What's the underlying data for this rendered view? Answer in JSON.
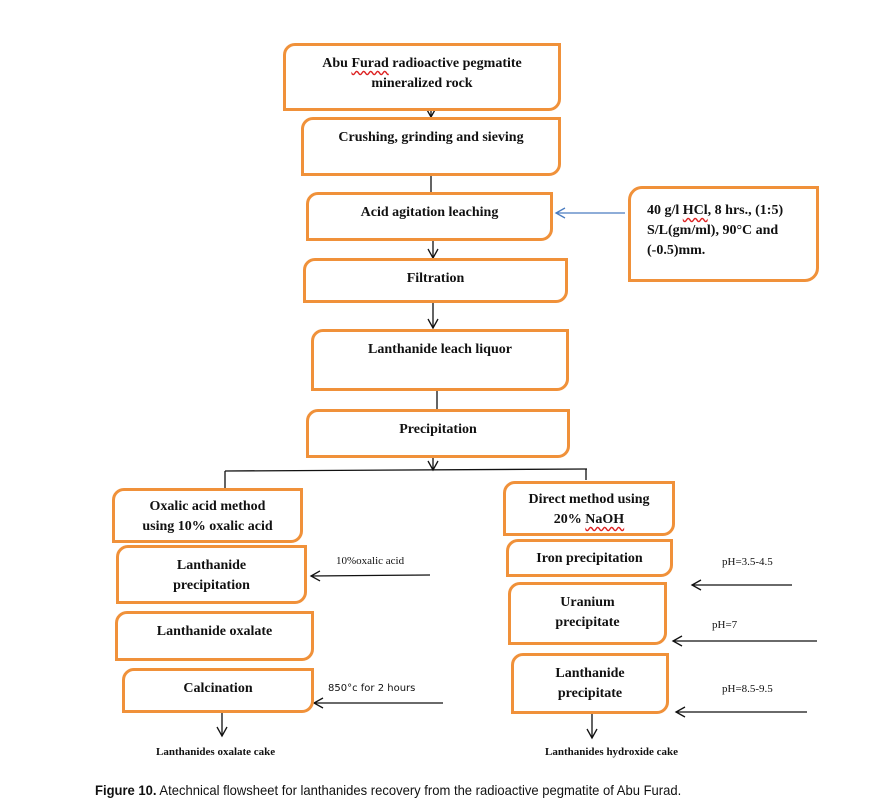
{
  "diagram": {
    "main_flow": [
      {
        "id": "ore",
        "lines": [
          "Abu Furad radioactive pegmatite",
          "mineralized rock"
        ]
      },
      {
        "id": "crushing",
        "lines": [
          "Crushing, grinding and sieving"
        ]
      },
      {
        "id": "leaching",
        "lines": [
          "Acid agitation leaching"
        ]
      },
      {
        "id": "filtration",
        "lines": [
          "Filtration"
        ]
      },
      {
        "id": "leach_liquor",
        "lines": [
          "Lanthanide leach liquor"
        ]
      },
      {
        "id": "precipitation",
        "lines": [
          "Precipitation"
        ]
      }
    ],
    "leaching_conditions": {
      "lines": [
        "40 g/l HCl, 8 hrs., (1:5)",
        "S/L(gm/ml), 90°C and",
        "(-0.5)mm."
      ]
    },
    "left_branch": {
      "boxes": [
        {
          "id": "oxalic_method",
          "lines": [
            "Oxalic acid method",
            "using 10% oxalic acid"
          ]
        },
        {
          "id": "lanthanide_precipitation",
          "lines": [
            "Lanthanide",
            "precipitation"
          ]
        },
        {
          "id": "lanthanide_oxalate",
          "lines": [
            "Lanthanide oxalate"
          ]
        },
        {
          "id": "calcination",
          "lines": [
            "Calcination"
          ]
        }
      ],
      "inputs": [
        {
          "target": "lanthanide_precipitation",
          "label": "10%oxalic acid"
        },
        {
          "target": "calcination",
          "label": "850°c for 2 hours"
        }
      ],
      "output": "Lanthanides oxalate cake"
    },
    "right_branch": {
      "boxes": [
        {
          "id": "direct_method",
          "lines": [
            "Direct method using",
            "20% NaOH"
          ]
        },
        {
          "id": "iron_precipitation",
          "lines": [
            "Iron precipitation"
          ]
        },
        {
          "id": "uranium_precipitate",
          "lines": [
            "Uranium",
            "precipitate"
          ]
        },
        {
          "id": "lanthanide_precipitate",
          "lines": [
            "Lanthanide",
            "precipitate"
          ]
        }
      ],
      "inputs": [
        {
          "target": "iron_precipitation",
          "label": "pH=3.5-4.5"
        },
        {
          "target": "uranium_precipitate",
          "label": "pH=7"
        },
        {
          "target": "lanthanide_precipitate",
          "label": "pH=8.5-9.5"
        }
      ],
      "output": "Lanthanides hydroxide cake"
    },
    "colors": {
      "box_border": "#f0913a",
      "connector": "#111111",
      "condition_arrow": "#4a7cc0"
    }
  },
  "caption": {
    "label": "Figure 10.",
    "text": " Atechnical flowsheet for lanthanides recovery from the radioactive pegmatite of Abu Furad."
  }
}
